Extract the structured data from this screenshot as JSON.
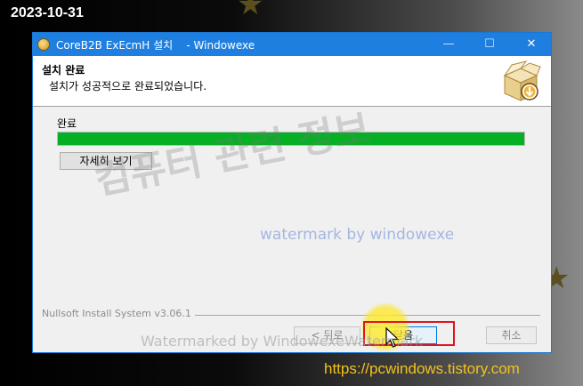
{
  "background": {
    "date": "2023-10-31",
    "url": "https://pcwindows.tistory.com"
  },
  "window": {
    "title": "CoreB2B ExEcmH 설치    - Windowexe",
    "controls": {
      "minimize": "—",
      "maximize": "☐",
      "close": "✕"
    },
    "header": {
      "title": "설치 완료",
      "subtitle": "설치가 성공적으로 완료되었습니다.",
      "icon": "installer-box-icon"
    },
    "status": {
      "label": "완료",
      "progress_percent": 100,
      "details_button": "자세히 보기"
    },
    "branding": "Nullsoft Install System v3.06.1",
    "buttons": {
      "back": "< 뒤로",
      "close": "닫음",
      "cancel": "취소"
    }
  },
  "watermarks": {
    "korean": "컴퓨터 관련 정보",
    "blue": "watermark by windowexe",
    "bottom": "Watermarked by WindowexeWatermark"
  },
  "colors": {
    "titlebar": "#1f7fe0",
    "progress": "#06b025",
    "highlight": "#e0141e",
    "url": "#f4c21a"
  }
}
